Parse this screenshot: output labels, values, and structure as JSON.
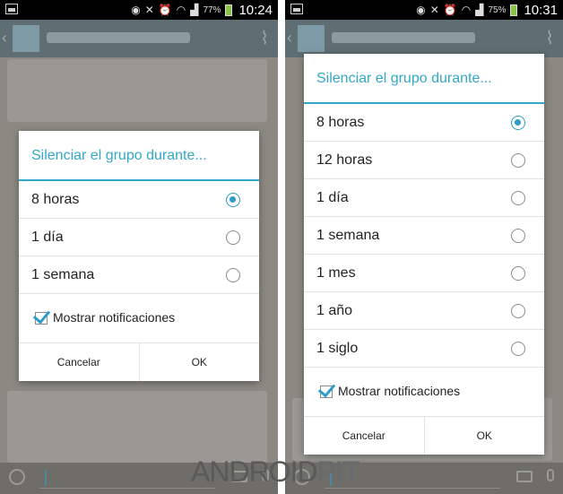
{
  "left": {
    "status": {
      "battery": "77%",
      "time": "10:24"
    },
    "dialog": {
      "title": "Silenciar el grupo durante...",
      "options": [
        {
          "label": "8 horas",
          "selected": true
        },
        {
          "label": "1 día",
          "selected": false
        },
        {
          "label": "1 semana",
          "selected": false
        }
      ],
      "notifications_label": "Mostrar notificaciones",
      "notifications_checked": true,
      "cancel_label": "Cancelar",
      "ok_label": "OK"
    }
  },
  "right": {
    "status": {
      "battery": "75%",
      "time": "10:31"
    },
    "dialog": {
      "title": "Silenciar el grupo durante...",
      "options": [
        {
          "label": "8 horas",
          "selected": true
        },
        {
          "label": "12 horas",
          "selected": false
        },
        {
          "label": "1 día",
          "selected": false
        },
        {
          "label": "1 semana",
          "selected": false
        },
        {
          "label": "1 mes",
          "selected": false
        },
        {
          "label": "1 año",
          "selected": false
        },
        {
          "label": "1 siglo",
          "selected": false
        }
      ],
      "notifications_label": "Mostrar notificaciones",
      "notifications_checked": true,
      "cancel_label": "Cancelar",
      "ok_label": "OK"
    }
  },
  "watermark": {
    "part1": "ANDROID",
    "part2": "PIT"
  },
  "colors": {
    "accent": "#33a7c8",
    "radio_selected": "#2d9cc8",
    "battery": "#8bc34a"
  },
  "icons": [
    "gallery-icon",
    "eye-icon",
    "mute-icon",
    "alarm-icon",
    "wifi-icon",
    "signal-icon",
    "battery-icon",
    "paperclip-icon",
    "emoji-icon",
    "camera-icon",
    "microphone-icon"
  ]
}
